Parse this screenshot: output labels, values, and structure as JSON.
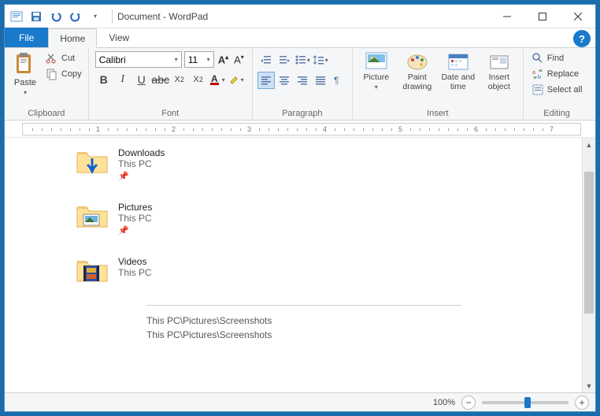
{
  "title": "Document - WordPad",
  "tabs": {
    "file": "File",
    "home": "Home",
    "view": "View"
  },
  "clipboard": {
    "paste": "Paste",
    "cut": "Cut",
    "copy": "Copy",
    "label": "Clipboard"
  },
  "font": {
    "name": "Calibri",
    "size": "11",
    "label": "Font"
  },
  "paragraph": {
    "label": "Paragraph"
  },
  "insert": {
    "picture": "Picture",
    "paint": "Paint\ndrawing",
    "datetime": "Date and\ntime",
    "object": "Insert\nobject",
    "label": "Insert"
  },
  "editing": {
    "find": "Find",
    "replace": "Replace",
    "selectall": "Select all",
    "label": "Editing"
  },
  "ruler_ticks": [
    "1",
    "2",
    "3",
    "4",
    "5",
    "6",
    "7"
  ],
  "folders": [
    {
      "name": "Downloads",
      "sub": "This PC",
      "pinned": true,
      "overlay": "arrow"
    },
    {
      "name": "Pictures",
      "sub": "This PC",
      "pinned": true,
      "overlay": "photo"
    },
    {
      "name": "Videos",
      "sub": "This PC",
      "pinned": false,
      "overlay": "film"
    }
  ],
  "paths": [
    "This PC\\Pictures\\Screenshots",
    "This PC\\Pictures\\Screenshots"
  ],
  "status": {
    "zoom": "100%"
  }
}
